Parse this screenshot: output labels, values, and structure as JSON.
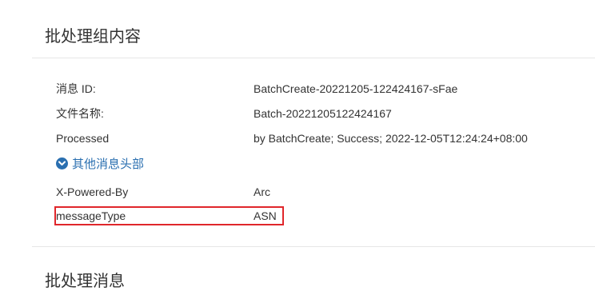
{
  "sections": {
    "group_content_title": "批处理组内容",
    "messages_title": "批处理消息"
  },
  "fields": {
    "message_id": {
      "label": "消息 ID:",
      "value": "BatchCreate-20221205-122424167-sFae"
    },
    "file_name": {
      "label": "文件名称:",
      "value": "Batch-20221205122424167"
    },
    "processed": {
      "label": "Processed",
      "value": "by BatchCreate; Success; 2022-12-05T12:24:24+08:00"
    }
  },
  "other_headers": {
    "toggle_label": "其他消息头部",
    "icon": "chevron-down-circle-icon",
    "rows": [
      {
        "label": "X-Powered-By",
        "value": "Arc"
      },
      {
        "label": "messageType",
        "value": "ASN"
      }
    ]
  },
  "colors": {
    "link": "#2a6fb0",
    "highlight": "#e0262b",
    "divider": "#e6e6e6",
    "text": "#333333"
  }
}
